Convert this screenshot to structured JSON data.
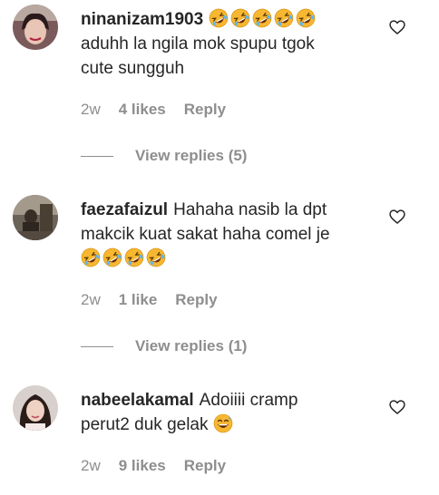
{
  "comments": [
    {
      "username": "ninanizam1903",
      "text_line1": "aduhh la ngila mok spupu tgok",
      "text_line2": "cute sungguh",
      "emoji_count": 5,
      "emoji": "rofl",
      "age": "2w",
      "likes": "4 likes",
      "reply": "Reply",
      "view_replies": "View replies (5)"
    },
    {
      "username": "faezafaizul",
      "text_line1": "Hahaha nasib la dpt",
      "text_line2": "makcik kuat sakat haha comel je",
      "emoji_count": 4,
      "emoji": "rofl",
      "age": "2w",
      "likes": "1 like",
      "reply": "Reply",
      "view_replies": "View replies (1)"
    },
    {
      "username": "nabeelakamal",
      "text_line1": "Adoiiii cramp",
      "text_line2": "perut2 duk gelak",
      "emoji": "grinning-sweat",
      "age": "2w",
      "likes": "9 likes",
      "reply": "Reply"
    }
  ],
  "colors": {
    "text": "#262626",
    "muted": "#8e8e8e",
    "emoji_yellow": "#f7b731"
  },
  "icons": [
    "heart-outline-icon",
    "rofl-emoji",
    "grinning-sweat-emoji"
  ]
}
